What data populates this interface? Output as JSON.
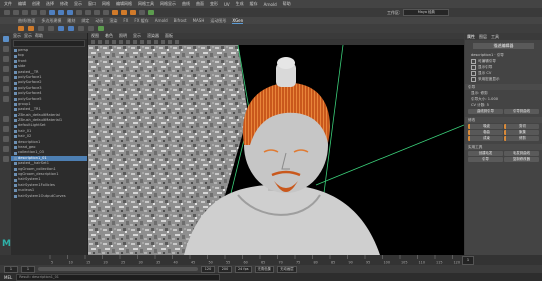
{
  "menubar": {
    "items": [
      "文件",
      "编辑",
      "创建",
      "选择",
      "修改",
      "显示",
      "窗口",
      "网格",
      "编辑网格",
      "网格工具",
      "网格显示",
      "曲线",
      "曲面",
      "变形",
      "UV",
      "生成",
      "缓存",
      "Arnold",
      "帮助"
    ],
    "workspace_label": "工作区:",
    "workspace_value": "Maya 经典",
    "selected": "XGen"
  },
  "shelf": {
    "tabs": [
      "曲线/曲面",
      "多边形建模",
      "雕刻",
      "绑定",
      "动画",
      "渲染",
      "FX",
      "FX 缓存",
      "Arnold",
      "Bifrost",
      "MASH",
      "运动图形",
      "XGen"
    ],
    "active": "XGen"
  },
  "outliner": {
    "menus": [
      "显示",
      "显示",
      "帮助"
    ],
    "items": [
      {
        "label": "persp",
        "selected": false
      },
      {
        "label": "top",
        "selected": false
      },
      {
        "label": "front",
        "selected": false
      },
      {
        "label": "side",
        "selected": false
      },
      {
        "label": "pasted__TR",
        "selected": false
      },
      {
        "label": "polySurface1",
        "selected": false
      },
      {
        "label": "polySurface2",
        "selected": false
      },
      {
        "label": "polySurface3",
        "selected": false
      },
      {
        "label": "polySurface4",
        "selected": false
      },
      {
        "label": "polySurface5",
        "selected": false
      },
      {
        "label": "group1",
        "selected": false
      },
      {
        "label": "pasted__TR1",
        "selected": false
      },
      {
        "label": "ZBrush_defaultMaterial",
        "selected": false
      },
      {
        "label": "ZBrush_defaultMaterial1",
        "selected": false
      },
      {
        "label": "defaultLightSet",
        "selected": false
      },
      {
        "label": "hair_01",
        "selected": false
      },
      {
        "label": "hair_02",
        "selected": false
      },
      {
        "label": "description1",
        "selected": false
      },
      {
        "label": "head_geo",
        "selected": false
      },
      {
        "label": "collection1_03",
        "selected": false
      },
      {
        "label": "description1_01",
        "selected": true
      },
      {
        "label": "pasted__hairSet1",
        "selected": false
      },
      {
        "label": "xgGroom_collection1",
        "selected": false
      },
      {
        "label": "xgGroom_description1",
        "selected": false
      },
      {
        "label": "hairSystem1",
        "selected": false
      },
      {
        "label": "hairSystem1Follicles",
        "selected": false
      },
      {
        "label": "nucleus1",
        "selected": false
      },
      {
        "label": "hairSystem1OutputCurves",
        "selected": false
      }
    ]
  },
  "viewport": {
    "menus": [
      "视图",
      "着色",
      "照明",
      "显示",
      "渲染器",
      "面板"
    ]
  },
  "attribute_panel": {
    "tabs": [
      "属性",
      "图层",
      "工具"
    ],
    "node_name": "描述编辑器",
    "rows": [
      {
        "type": "text",
        "label": "description1 · 引导"
      },
      {
        "type": "check",
        "label": "可编辑引导"
      },
      {
        "type": "check",
        "label": "显示引导"
      },
      {
        "type": "check",
        "label": "显示 CV"
      },
      {
        "type": "check",
        "label": "采用密度显示"
      }
    ],
    "section1": "引导",
    "section1_rows": [
      "显示: 修剪",
      "引导大小: 1.000",
      "CV 计数: 5"
    ],
    "section2_rows": [
      "曲线到引导",
      "引导到曲线"
    ],
    "mod_section": "修改",
    "mod_buttons": [
      "噪波",
      "剪切",
      "卷曲",
      "聚集",
      "成束",
      "修剪"
    ],
    "util_section": "实用工具",
    "util_buttons": [
      "创建毛发",
      "毛发到曲线",
      "引导",
      "复制修改器"
    ]
  },
  "timeline": {
    "ticks": [
      "5",
      "10",
      "15",
      "20",
      "25",
      "30",
      "35",
      "40",
      "45",
      "50",
      "55",
      "60",
      "65",
      "70",
      "75",
      "80",
      "85",
      "90",
      "95",
      "100",
      "105",
      "110",
      "115",
      "120"
    ],
    "current_frame": "1"
  },
  "range_slider": {
    "start": "1",
    "inner_start": "1",
    "inner_end": "120",
    "end": "200",
    "fps": "24 fps",
    "char_set": "无角色集",
    "anim_layer": "无动画层"
  },
  "command_line": {
    "language": "MEL",
    "hint": "Result: description1_01"
  }
}
